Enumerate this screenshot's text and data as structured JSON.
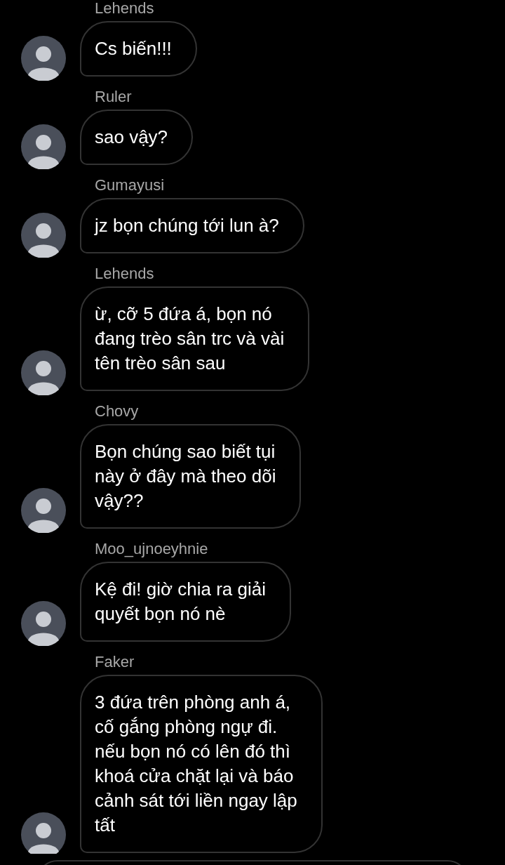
{
  "messages": [
    {
      "sender": "Lehends",
      "text": "Cs biến!!!"
    },
    {
      "sender": "Ruler",
      "text": "sao vậy?"
    },
    {
      "sender": "Gumayusi",
      "text": "jz bọn chúng tới lun à?"
    },
    {
      "sender": "Lehends",
      "text": "ừ, cỡ 5 đứa á, bọn nó\nđang trèo sân trc và vài\ntên trèo sân sau"
    },
    {
      "sender": "Chovy",
      "text": "Bọn chúng sao biết tụi\nnày ở đây mà theo dõi\nvậy??"
    },
    {
      "sender": "Moo_ujnoeyhnie",
      "text": "Kệ đi! giờ chia ra giải\nquyết bọn nó nè"
    },
    {
      "sender": "Faker",
      "text": "3 đứa trên phòng anh á,\ncố gắng phòng ngự đi.\nnếu bọn nó có lên đó thì\nkhoá cửa chặt lại và báo\ncảnh sát tới liền ngay lập\ntất"
    }
  ]
}
